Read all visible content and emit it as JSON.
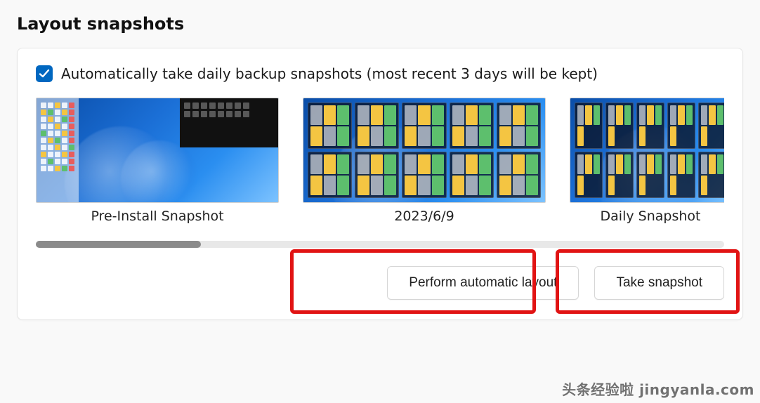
{
  "section": {
    "title": "Layout snapshots"
  },
  "checkbox": {
    "checked": true,
    "label": "Automatically take daily backup snapshots (most recent 3 days will be kept)"
  },
  "snapshots": [
    {
      "caption": "Pre-Install Snapshot"
    },
    {
      "caption": "2023/6/9"
    },
    {
      "caption": "Daily Snapshot"
    }
  ],
  "buttons": {
    "perform_auto_layout": "Perform automatic layout",
    "take_snapshot": "Take snapshot"
  },
  "watermark": "头条经验啦 jingyanla.com"
}
